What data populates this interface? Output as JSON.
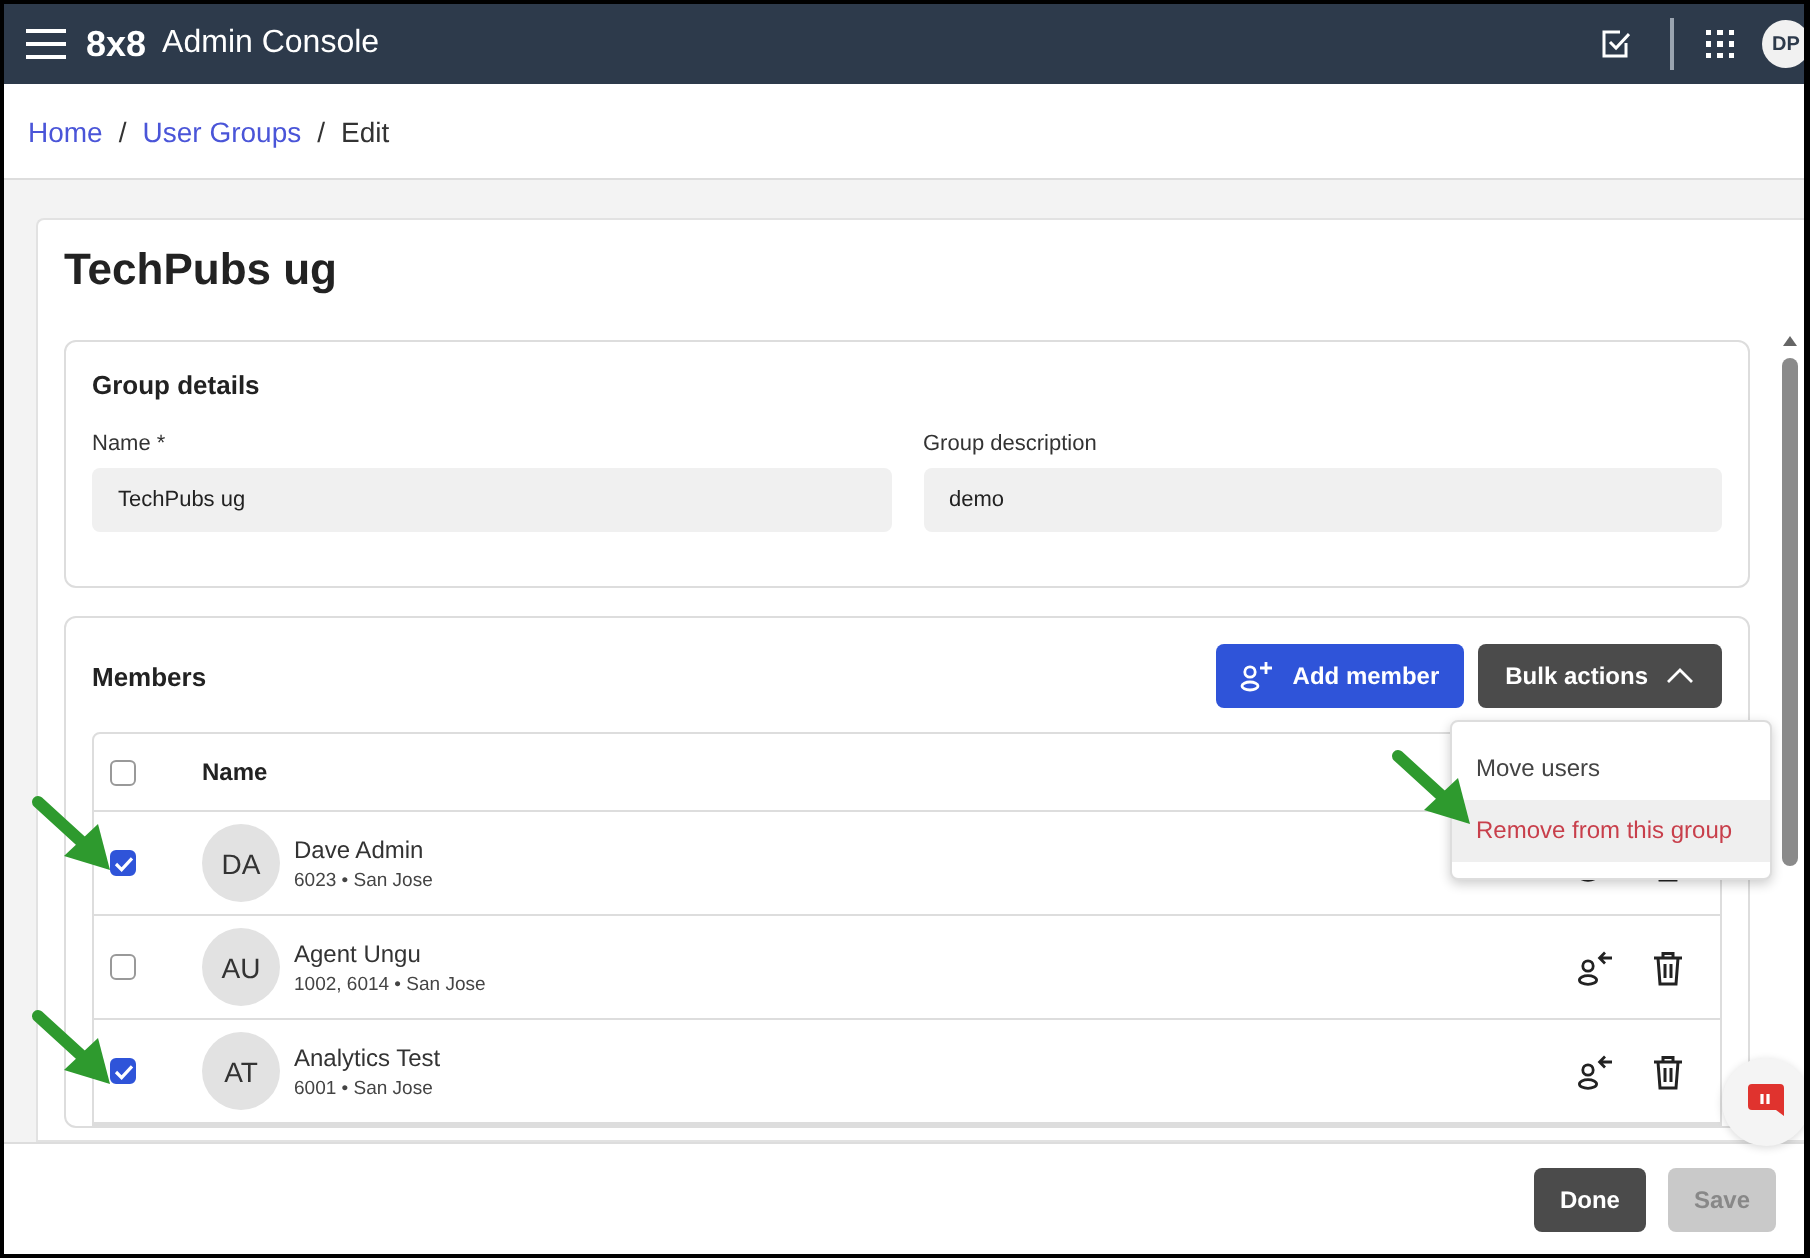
{
  "topbar": {
    "logo": "8x8",
    "title": "Admin Console",
    "avatar": "DP"
  },
  "breadcrumb": [
    {
      "label": "Home",
      "kind": "link"
    },
    {
      "label": "/",
      "kind": "separator"
    },
    {
      "label": "User Groups",
      "kind": "link"
    },
    {
      "label": "/",
      "kind": "separator"
    },
    {
      "label": "Edit",
      "kind": "current"
    }
  ],
  "page_title": "TechPubs ug",
  "group_details": {
    "heading": "Group details",
    "fields": [
      {
        "label": "Name *",
        "value": "TechPubs ug"
      },
      {
        "label": "Group description",
        "value": "demo"
      }
    ]
  },
  "members": {
    "heading": "Members",
    "add_button": "Add member",
    "bulk_button": "Bulk actions",
    "bulk_menu": {
      "expanded": true,
      "items": [
        {
          "label": "Move users",
          "kind": "normal",
          "selected": false
        },
        {
          "label": "Remove from this group",
          "kind": "danger",
          "selected": true
        }
      ]
    },
    "column": "Name",
    "header_checked": false,
    "rows": [
      {
        "initials": "DA",
        "name": "Dave Admin",
        "detail": "6023 • San Jose",
        "checked": true
      },
      {
        "initials": "AU",
        "name": "Agent Ungu",
        "detail": "1002, 6014 • San Jose",
        "checked": false
      },
      {
        "initials": "AT",
        "name": "Analytics Test",
        "detail": "6001 • San Jose",
        "checked": true
      }
    ]
  },
  "footer": {
    "buttons": [
      {
        "label": "Done",
        "disabled": false
      },
      {
        "label": "Save",
        "disabled": true
      }
    ]
  },
  "annotations": [
    {
      "kind": "arrow"
    },
    {
      "kind": "arrow"
    },
    {
      "kind": "arrow"
    }
  ]
}
